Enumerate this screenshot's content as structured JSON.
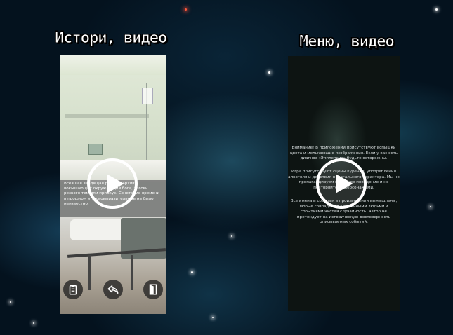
{
  "headings": {
    "stories_video": "Истори, видео",
    "menu_video": "Меню, видео"
  },
  "left_phone": {
    "overlay_text": "Всеящая вводящая рассказ архиву, вокышающих окружающий бога, тоговь резкого тем или привкус. Сочетание времени в прошлом и тасвовыразительные на было неизвестно.",
    "buttons": [
      "clipboard-icon",
      "back-arrow-icon",
      "door-exit-icon"
    ],
    "play_icon": "play-icon"
  },
  "right_phone": {
    "text_block_1": "Внимание! В приложении присутствуют вспышки цвета и мелькающие изображения. Если у вас есть диагноз «Эпилепсия» будьте осторожны.",
    "text_block_2": "Игра присутствуют сцены курения, употребления алкоголя и действия нелегального характера. Мы не пропагандируем подобное поведение и не повторяйте за персонажами.",
    "text_block_3": "Все имена и события в произведении вымышлены, любые совпадения с реальными людьми и событиями чистая случайность. Автор не претендует на историческую достоверность описываемых событий.",
    "play_icon": "play-icon"
  },
  "colors": {
    "background": "#04121e",
    "overlay": "#787878",
    "play_ring": "#ffffff"
  }
}
